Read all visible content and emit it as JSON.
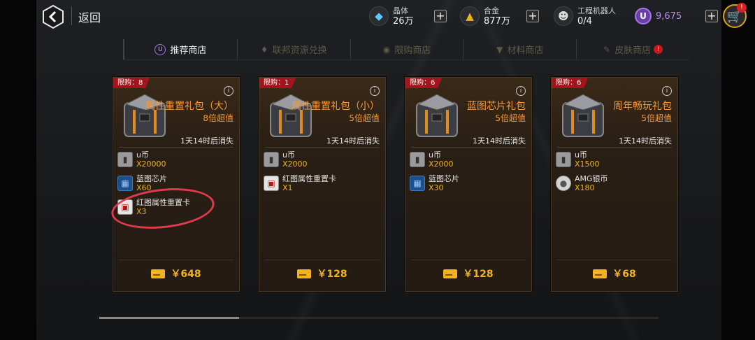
{
  "header": {
    "back_label": "返回",
    "resources": [
      {
        "label": "晶体",
        "value": "26万",
        "icon": "crystal-icon"
      },
      {
        "label": "合金",
        "value": "877万",
        "icon": "alloy-icon"
      },
      {
        "label": "工程机器人",
        "value": "0/4",
        "icon": "robot-icon"
      }
    ],
    "ucoin": {
      "symbol": "U",
      "value": "9,675"
    },
    "cart_badge": "!"
  },
  "tabs": [
    {
      "label": "推荐商店",
      "icon": "U"
    },
    {
      "label": "联邦资源兑换",
      "icon": "♦"
    },
    {
      "label": "限购商店",
      "icon": "◉"
    },
    {
      "label": "材料商店",
      "icon": "▼"
    },
    {
      "label": "皮肤商店",
      "icon": "✎",
      "badge": "!"
    }
  ],
  "cards": [
    {
      "limit": "限购：8",
      "title": "属性重置礼包（大）",
      "value": "8倍超值",
      "expire": "1天14时后消失",
      "items": [
        {
          "name": "u币",
          "qty": "X20000",
          "icon": "ucoin-icon"
        },
        {
          "name": "蓝图芯片",
          "qty": "X60",
          "icon": "chip-icon"
        },
        {
          "name": "红图属性重置卡",
          "qty": "X3",
          "icon": "reset-card-icon"
        }
      ],
      "price": "￥648"
    },
    {
      "limit": "限购：1",
      "title": "属性重置礼包（小）",
      "value": "5倍超值",
      "expire": "1天14时后消失",
      "items": [
        {
          "name": "u币",
          "qty": "X2000",
          "icon": "ucoin-icon"
        },
        {
          "name": "红图属性重置卡",
          "qty": "X1",
          "icon": "reset-card-icon"
        }
      ],
      "price": "￥128"
    },
    {
      "limit": "限购：6",
      "title": "蓝图芯片礼包",
      "value": "5倍超值",
      "expire": "1天14时后消失",
      "items": [
        {
          "name": "u币",
          "qty": "X2000",
          "icon": "ucoin-icon"
        },
        {
          "name": "蓝图芯片",
          "qty": "X30",
          "icon": "chip-icon"
        }
      ],
      "price": "￥128"
    },
    {
      "limit": "限购：6",
      "title": "周年畅玩礼包",
      "value": "5倍超值",
      "expire": "1天14时后消失",
      "items": [
        {
          "name": "u币",
          "qty": "X1500",
          "icon": "ucoin-icon"
        },
        {
          "name": "AMG银币",
          "qty": "X180",
          "icon": "silver-coin-icon"
        }
      ],
      "price": "￥68"
    }
  ]
}
